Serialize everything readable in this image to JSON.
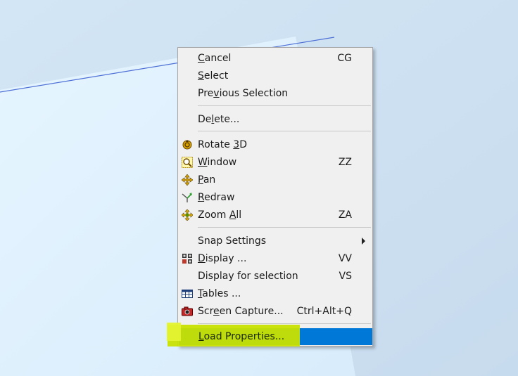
{
  "menu": {
    "items": [
      {
        "pre": "",
        "ul": "C",
        "post": "ancel",
        "shortcut": "CG"
      },
      {
        "pre": "",
        "ul": "S",
        "post": "elect",
        "shortcut": ""
      },
      {
        "pre": "Pre",
        "ul": "v",
        "post": "ious Selection",
        "shortcut": ""
      },
      {
        "pre": "De",
        "ul": "l",
        "post": "ete...",
        "shortcut": ""
      },
      {
        "pre": "Rotate ",
        "ul": "3",
        "post": "D",
        "shortcut": "",
        "icon": "rotate-3d-icon"
      },
      {
        "pre": "",
        "ul": "W",
        "post": "indow",
        "shortcut": "ZZ",
        "icon": "zoom-window-icon"
      },
      {
        "pre": "",
        "ul": "P",
        "post": "an",
        "shortcut": "",
        "icon": "pan-icon"
      },
      {
        "pre": "",
        "ul": "R",
        "post": "edraw",
        "shortcut": "",
        "icon": "redraw-icon"
      },
      {
        "pre": "Zoom ",
        "ul": "A",
        "post": "ll",
        "shortcut": "ZA",
        "icon": "zoom-all-icon"
      },
      {
        "pre": "Snap Settings",
        "ul": "",
        "post": "",
        "shortcut": ""
      },
      {
        "pre": "",
        "ul": "D",
        "post": "isplay ...",
        "shortcut": "VV",
        "icon": "display-icon"
      },
      {
        "pre": "Display for selection",
        "ul": "",
        "post": "",
        "shortcut": "VS"
      },
      {
        "pre": "",
        "ul": "T",
        "post": "ables ...",
        "shortcut": "",
        "icon": "tables-icon"
      },
      {
        "pre": "Scr",
        "ul": "e",
        "post": "en Capture...",
        "shortcut": "Ctrl+Alt+Q",
        "icon": "camera-icon"
      },
      {
        "pre": "",
        "ul": "L",
        "post": "oad Properties...",
        "shortcut": ""
      }
    ]
  },
  "colors": {
    "selection": "#0078d7",
    "highlighter": "#cfe80a"
  }
}
